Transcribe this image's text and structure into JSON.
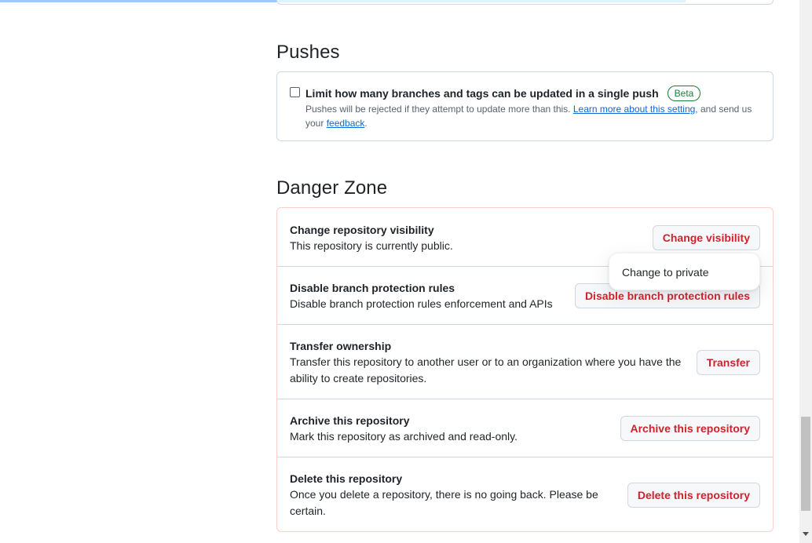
{
  "pushes": {
    "title": "Pushes",
    "limit_label": "Limit how many branches and tags can be updated in a single push",
    "beta_badge": "Beta",
    "note_before": "Pushes will be rejected if they attempt to update more than this. ",
    "learn_more_link": "Learn more about this setting",
    "note_middle": ", and send us your ",
    "feedback_link": "feedback",
    "note_end": ".",
    "checked": false
  },
  "danger_zone": {
    "title": "Danger Zone",
    "rows": [
      {
        "title": "Change repository visibility",
        "description": "This repository is currently public.",
        "button": "Change visibility"
      },
      {
        "title": "Disable branch protection rules",
        "description": "Disable branch protection rules enforcement and APIs",
        "button": "Disable branch protection rules"
      },
      {
        "title": "Transfer ownership",
        "description": "Transfer this repository to another user or to an organization where you have the ability to create repositories.",
        "button": "Transfer"
      },
      {
        "title": "Archive this repository",
        "description": "Mark this repository as archived and read-only.",
        "button": "Archive this repository"
      },
      {
        "title": "Delete this repository",
        "description": "Once you delete a repository, there is no going back. Please be certain.",
        "button": "Delete this repository"
      }
    ]
  },
  "visibility_menu": {
    "items": [
      "Change to private"
    ]
  },
  "colors": {
    "danger": "#cf222e",
    "danger_border": "#ffcecb",
    "link": "#0969da",
    "success": "#1a7f37",
    "progress": "#9ecbff"
  }
}
